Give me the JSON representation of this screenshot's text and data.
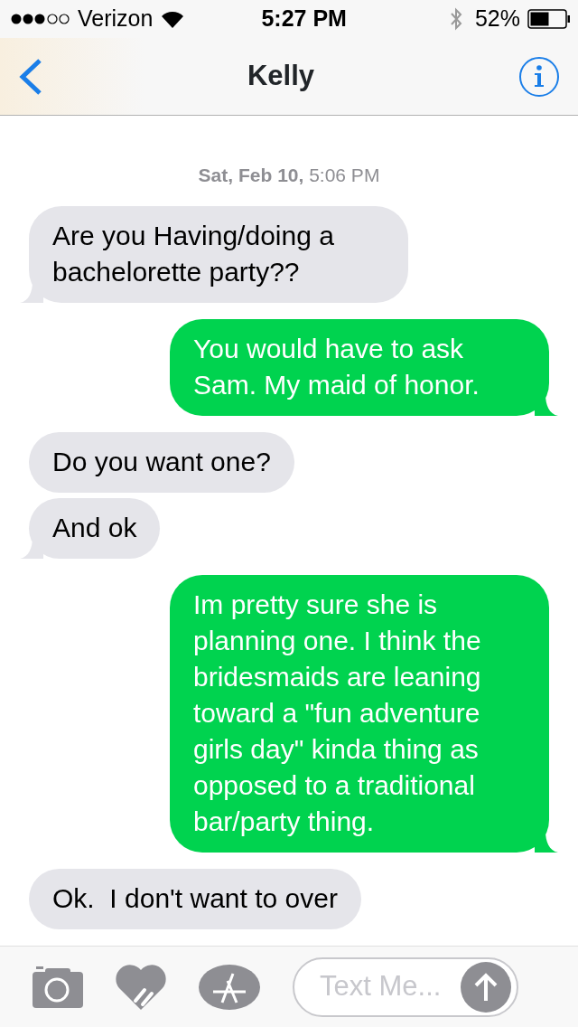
{
  "status_bar": {
    "carrier": "Verizon",
    "time": "5:27 PM",
    "battery": "52%"
  },
  "nav": {
    "title": "Kelly"
  },
  "timestamp": "**Sat, Feb 10,** 5:06 PM",
  "messages": [
    {
      "kind": "incoming",
      "text": "Are you Having/doing a bachelorette party??",
      "tail": true
    },
    {
      "kind": "outgoing",
      "text": "You would have to ask Sam. My maid of honor.",
      "tail": true
    },
    {
      "kind": "incoming",
      "text": "Do you want one?",
      "tail": false
    },
    {
      "kind": "incoming",
      "text": "And ok",
      "tail": true
    },
    {
      "kind": "outgoing",
      "text": "Im pretty sure she is planning one. I think the bridesmaids are leaning toward a \"fun adventure girls day\" kinda thing as opposed to a traditional bar/party thing.",
      "tail": true
    },
    {
      "kind": "incoming",
      "text": "Ok.  I don't want to over",
      "tail": false
    }
  ],
  "composer": {
    "placeholder": "Text Me..."
  }
}
